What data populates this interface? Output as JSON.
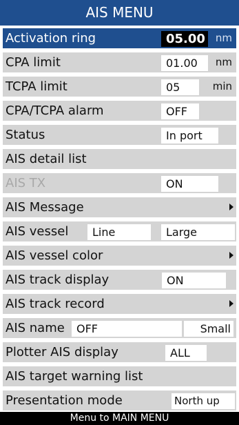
{
  "header": {
    "title": "AIS MENU"
  },
  "rows": {
    "activation_ring": {
      "label": "Activation ring",
      "value": "05.00",
      "unit": "nm"
    },
    "cpa_limit": {
      "label": "CPA limit",
      "value": "01.00",
      "unit": "nm"
    },
    "tcpa_limit": {
      "label": "TCPA limit",
      "value": "05",
      "unit": "min"
    },
    "cpa_tcpa_alarm": {
      "label": "CPA/TCPA alarm",
      "value": "OFF"
    },
    "status": {
      "label": "Status",
      "value": "In port"
    },
    "ais_detail_list": {
      "label": "AIS detail list"
    },
    "ais_tx": {
      "label": "AIS TX",
      "value": "ON"
    },
    "ais_message": {
      "label": "AIS Message"
    },
    "ais_vessel": {
      "label": "AIS vessel",
      "value1": "Line",
      "value2": "Large"
    },
    "ais_vessel_color": {
      "label": "AIS vessel color"
    },
    "ais_track_display": {
      "label": "AIS track display",
      "value": "ON"
    },
    "ais_track_record": {
      "label": "AIS track record"
    },
    "ais_name": {
      "label": "AIS name",
      "value1": "OFF",
      "value2": "Small"
    },
    "plotter_ais_display": {
      "label": "Plotter AIS display",
      "value": "ALL"
    },
    "ais_target_warning_list": {
      "label": "AIS target warning list"
    },
    "presentation_mode": {
      "label": "Presentation mode",
      "value": "North up"
    }
  },
  "footer": {
    "text": "Menu to MAIN MENU"
  },
  "colors": {
    "header_bg": "#1f4f8f",
    "row_bg": "#d4d4d4",
    "selected_bg": "#1f4f8f",
    "footer_bg": "#000000"
  },
  "icons": [
    "submenu-arrow-icon"
  ]
}
